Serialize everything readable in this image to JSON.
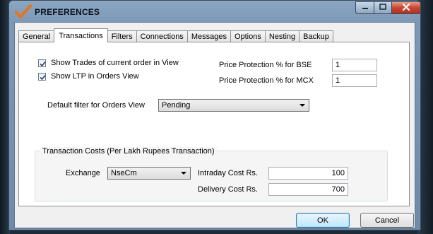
{
  "window": {
    "title": "PREFERENCES",
    "controls": {
      "minimize": "minimize",
      "maximize": "maximize",
      "close": "close"
    }
  },
  "tabs": [
    "General",
    "Transactions",
    "Filters",
    "Connections",
    "Messages",
    "Options",
    "Nesting",
    "Backup"
  ],
  "active_tab": "Transactions",
  "transactions": {
    "show_trades_label": "Show Trades of current order in View",
    "show_trades_checked": true,
    "show_ltp_label": "Show LTP in Orders View",
    "show_ltp_checked": true,
    "price_protection_bse_label": "Price Protection % for BSE",
    "price_protection_bse_value": "1",
    "price_protection_mcx_label": "Price Protection % for MCX",
    "price_protection_mcx_value": "1",
    "default_filter_label": "Default filter for Orders View",
    "default_filter_value": "Pending",
    "costs_group_label": "Transaction Costs (Per Lakh Rupees Transaction)",
    "exchange_label": "Exchange",
    "exchange_value": "NseCm",
    "intraday_cost_label": "Intraday Cost Rs.",
    "intraday_cost_value": "100",
    "delivery_cost_label": "Delivery Cost Rs.",
    "delivery_cost_value": "700"
  },
  "buttons": {
    "ok": "OK",
    "cancel": "Cancel"
  }
}
